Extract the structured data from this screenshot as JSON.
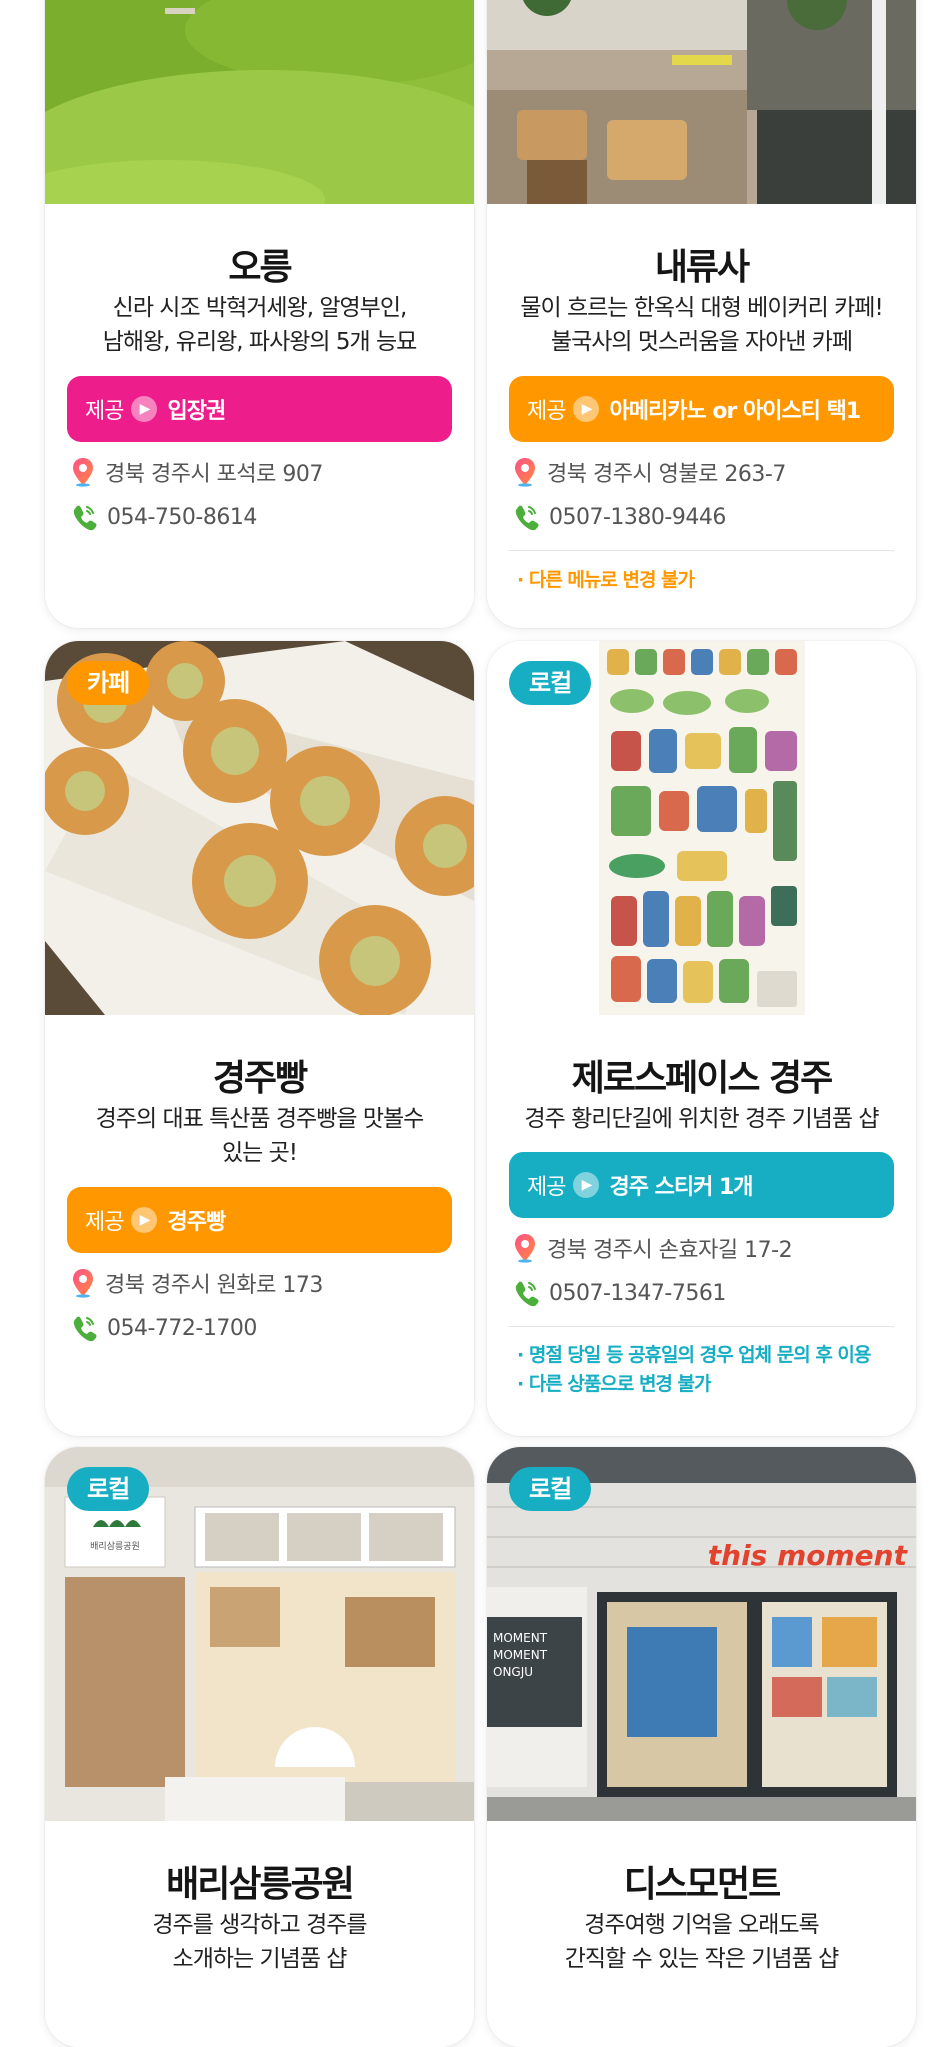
{
  "offer_label": "제공",
  "cards": [
    {
      "title": "오릉",
      "desc": [
        "신라 시조 박혁거세왕, 알영부인,",
        "남해왕, 유리왕, 파사왕의 5개 능묘"
      ],
      "offer": "입장권",
      "address": "경북 경주시 포석로 907",
      "phone": "054-750-8614"
    },
    {
      "title": "내류사",
      "desc": [
        "물이 흐르는 한옥식 대형 베이커리 카페!",
        "불국사의 멋스러움을 자아낸 카페"
      ],
      "offer": "아메리카노 or 아이스티 택1",
      "address": "경북 경주시 영불로 263-7",
      "phone": "0507-1380-9446",
      "notes": [
        "· 다른 메뉴로 변경 불가"
      ]
    },
    {
      "badge": "카페",
      "title": "경주빵",
      "desc": [
        "경주의 대표 특산품 경주빵을 맛볼수",
        "있는 곳!"
      ],
      "offer": "경주빵",
      "address": "경북 경주시 원화로 173",
      "phone": "054-772-1700"
    },
    {
      "badge": "로컬",
      "title": "제로스페이스 경주",
      "desc": [
        "경주 황리단길에 위치한 경주 기념품 샵"
      ],
      "offer": "경주 스티커 1개",
      "address": "경북 경주시 손효자길 17-2",
      "phone": "0507-1347-7561",
      "notes": [
        "· 명절 당일 등 공휴일의 경우 업체 문의 후 이용",
        "· 다른 상품으로 변경 불가"
      ]
    },
    {
      "badge": "로컬",
      "title": "배리삼릉공원",
      "desc": [
        "경주를 생각하고 경주를",
        "소개하는 기념품 샵"
      ],
      "sign": "배리삼릉공원"
    },
    {
      "badge": "로컬",
      "title": "디스모먼트",
      "desc": [
        "경주여행 기억을 오래도록",
        "간직할 수 있는 작은 기념품 샵"
      ],
      "sign": "this moment",
      "window_text": [
        "MOMENT",
        "MOMENT",
        "ONGJU"
      ]
    }
  ],
  "colors": {
    "pink": "#ee1d8c",
    "orange": "#ff9800",
    "teal": "#17aec4"
  }
}
